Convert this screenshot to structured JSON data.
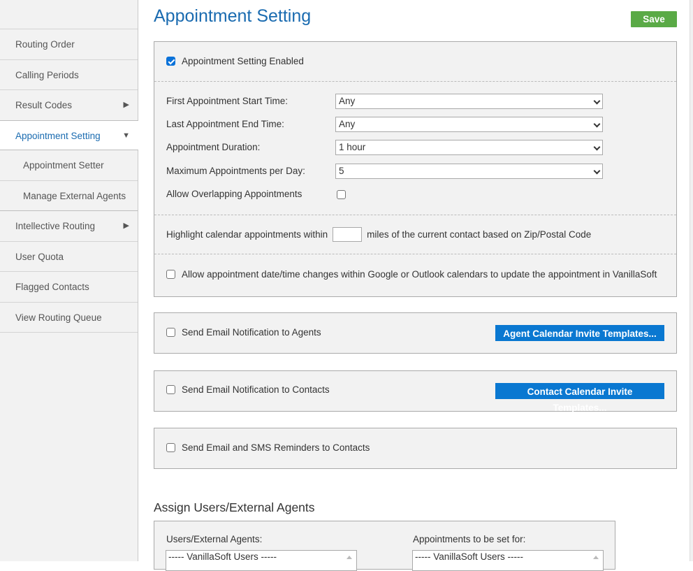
{
  "sidebar": {
    "items": [
      {
        "label": "Routing Order"
      },
      {
        "label": "Calling Periods"
      },
      {
        "label": "Result Codes",
        "caret": "▶"
      },
      {
        "label": "Appointment Setting",
        "caret": "▼",
        "active": true
      },
      {
        "label": "Appointment Setter",
        "sub": true
      },
      {
        "label": "Manage External Agents",
        "sub": true
      },
      {
        "label": "Intellective Routing",
        "caret": "▶"
      },
      {
        "label": "User Quota"
      },
      {
        "label": "Flagged Contacts"
      },
      {
        "label": "View Routing Queue"
      }
    ]
  },
  "header": {
    "title": "Appointment Setting",
    "save_label": "Save"
  },
  "settings": {
    "enabled_label": "Appointment Setting Enabled",
    "enabled_checked": true,
    "fields": [
      {
        "label": "First Appointment Start Time:",
        "value": "Any"
      },
      {
        "label": "Last Appointment End Time:",
        "value": "Any"
      },
      {
        "label": "Appointment Duration:",
        "value": "1 hour"
      },
      {
        "label": "Maximum Appointments per Day:",
        "value": "5"
      }
    ],
    "overlap_label": "Allow Overlapping Appointments",
    "overlap_checked": false,
    "highlight_prefix": "Highlight calendar appointments within",
    "highlight_value": "",
    "highlight_suffix": "miles of the current contact based on Zip/Postal Code",
    "calendar_sync_label": "Allow appointment date/time changes within Google or Outlook calendars to update the appointment in VanillaSoft",
    "calendar_sync_checked": false
  },
  "notifications": {
    "agents_label": "Send Email Notification to Agents",
    "agents_button": "Agent Calendar Invite Templates...",
    "contacts_label": "Send Email Notification to Contacts",
    "contacts_button": "Contact Calendar Invite Templates...",
    "reminders_label": "Send Email and SMS Reminders to Contacts"
  },
  "assign": {
    "title": "Assign Users/External Agents",
    "left_label": "Users/External Agents:",
    "left_first_option": "----- VanillaSoft Users -----",
    "right_label": "Appointments to be set for:",
    "right_first_option": "----- VanillaSoft Users -----"
  },
  "colors": {
    "accent_blue": "#1a6bb0",
    "button_blue": "#0a78d1",
    "save_green": "#5aaa46"
  }
}
